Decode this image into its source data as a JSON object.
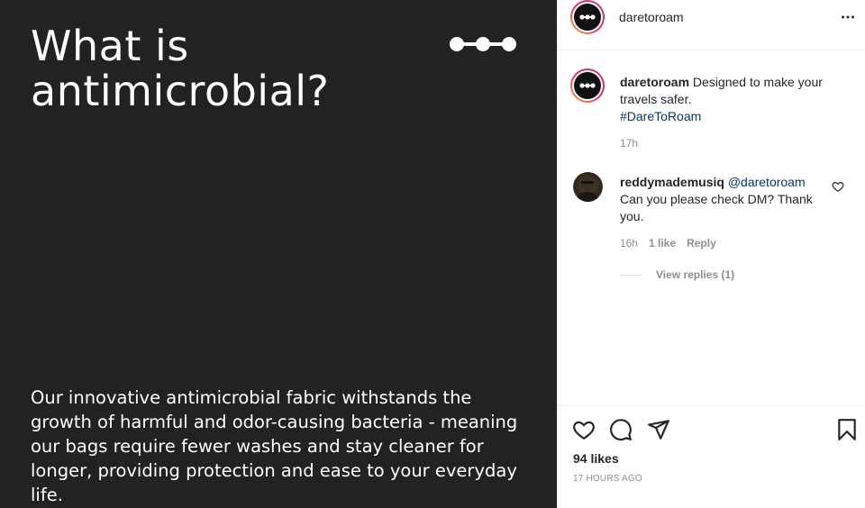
{
  "post": {
    "media": {
      "title": "What is\nantimicrobial?",
      "body": "Our innovative antimicrobial fabric withstands the growth of harmful and odor-causing bacteria - meaning our bags require fewer washes and stay cleaner for longer, providing protection and ease to your everyday life.",
      "brand_mark_icon": "three-dots-logo",
      "background_color": "#222222",
      "text_color": "#ffffff"
    },
    "header": {
      "username": "daretoroam",
      "more_icon": "more-horizontal-icon"
    },
    "caption": {
      "username": "daretoroam",
      "text": " Designed to make your travels safer.",
      "hashtag": "#DareToRoam",
      "time": "17h"
    },
    "comment": {
      "username": "reddymademusiq",
      "mention": "@daretoroam",
      "text": "Can you please check DM? Thank you.",
      "time": "16h",
      "likes": "1 like",
      "reply_label": "Reply",
      "view_replies": "View replies (1)"
    },
    "actions": {
      "icons": [
        "heart-icon",
        "comment-icon",
        "share-icon",
        "bookmark-icon"
      ],
      "likes": "94 likes",
      "time_ago": "17 HOURS AGO"
    },
    "colors": {
      "link": "#00376b",
      "muted": "#8e8e8e",
      "text": "#262626"
    }
  }
}
